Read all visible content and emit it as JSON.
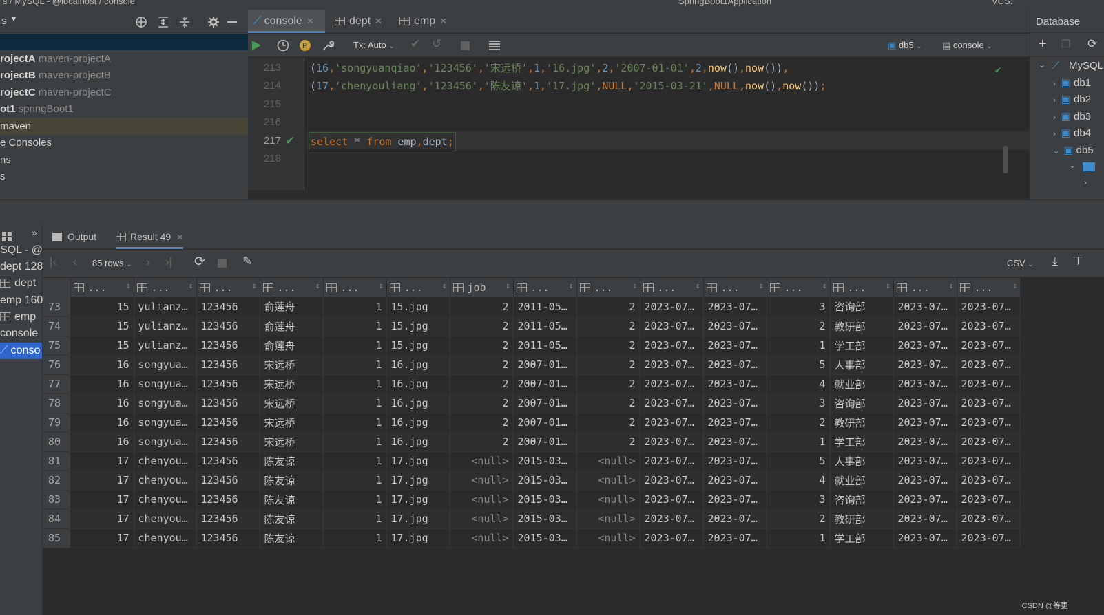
{
  "topbar": {
    "path": "s / MySQL - @localhost / console",
    "run_config": "SpringBoot1Application",
    "vcs": "VCS:"
  },
  "project_panel": {
    "header_label": "s",
    "items": [
      {
        "bold": "rojectA",
        "muted": "maven-projectA"
      },
      {
        "bold": "rojectB",
        "muted": "maven-projectB"
      },
      {
        "bold": "rojectC",
        "muted": "maven-projectC"
      },
      {
        "bold": "ot1",
        "muted": "springBoot1"
      },
      {
        "bold": "",
        "muted": "",
        "text": "maven"
      },
      {
        "bold": "",
        "muted": "",
        "text": "e Consoles"
      },
      {
        "bold": "",
        "muted": "",
        "text": "ns"
      },
      {
        "bold": "",
        "muted": "",
        "text": "s"
      }
    ]
  },
  "editor": {
    "tabs": [
      {
        "label": "console",
        "active": true
      },
      {
        "label": "dept"
      },
      {
        "label": "emp"
      }
    ],
    "toolbar": {
      "tx": "Tx: Auto",
      "schema": "db5",
      "session": "console"
    },
    "line_numbers": [
      "213",
      "214",
      "215",
      "216",
      "217",
      "218"
    ],
    "current_line": "217",
    "lines": [
      "(16,'songyuanqiao','123456','宋远桥',1,'16.jpg',2,'2007-01-01',2,now(),now()),",
      "(17,'chenyouliang','123456','陈友谅',1,'17.jpg',NULL,'2015-03-21',NULL,now(),now());",
      "",
      "",
      "select * from emp,dept;",
      ""
    ]
  },
  "database_panel": {
    "title": "Database",
    "root": "MySQL",
    "schemas": [
      "db1",
      "db2",
      "db3",
      "db4",
      "db5"
    ]
  },
  "services": {
    "items": [
      "SQL - @lo",
      "dept 128",
      "dept",
      "emp 160",
      "emp",
      "console",
      "conso"
    ],
    "selected": "conso"
  },
  "results": {
    "tabs": [
      {
        "label": "Output"
      },
      {
        "label": "Result 49",
        "active": true
      }
    ],
    "rows_label": "85 rows",
    "export_label": "CSV",
    "columns": [
      "...",
      "...",
      "...",
      "...",
      "...",
      "...",
      "job",
      "...",
      "...",
      "...",
      "...",
      "...",
      "...",
      "...",
      "..."
    ],
    "rows": [
      [
        "73",
        "15",
        "yulianz…",
        "123456",
        "俞莲舟",
        "1",
        "15.jpg",
        "2",
        "2011-05…",
        "2",
        "2023-07…",
        "2023-07…",
        "3",
        "咨询部",
        "2023-07…",
        "2023-07…"
      ],
      [
        "74",
        "15",
        "yulianz…",
        "123456",
        "俞莲舟",
        "1",
        "15.jpg",
        "2",
        "2011-05…",
        "2",
        "2023-07…",
        "2023-07…",
        "2",
        "教研部",
        "2023-07…",
        "2023-07…"
      ],
      [
        "75",
        "15",
        "yulianz…",
        "123456",
        "俞莲舟",
        "1",
        "15.jpg",
        "2",
        "2011-05…",
        "2",
        "2023-07…",
        "2023-07…",
        "1",
        "学工部",
        "2023-07…",
        "2023-07…"
      ],
      [
        "76",
        "16",
        "songyua…",
        "123456",
        "宋远桥",
        "1",
        "16.jpg",
        "2",
        "2007-01…",
        "2",
        "2023-07…",
        "2023-07…",
        "5",
        "人事部",
        "2023-07…",
        "2023-07…"
      ],
      [
        "77",
        "16",
        "songyua…",
        "123456",
        "宋远桥",
        "1",
        "16.jpg",
        "2",
        "2007-01…",
        "2",
        "2023-07…",
        "2023-07…",
        "4",
        "就业部",
        "2023-07…",
        "2023-07…"
      ],
      [
        "78",
        "16",
        "songyua…",
        "123456",
        "宋远桥",
        "1",
        "16.jpg",
        "2",
        "2007-01…",
        "2",
        "2023-07…",
        "2023-07…",
        "3",
        "咨询部",
        "2023-07…",
        "2023-07…"
      ],
      [
        "79",
        "16",
        "songyua…",
        "123456",
        "宋远桥",
        "1",
        "16.jpg",
        "2",
        "2007-01…",
        "2",
        "2023-07…",
        "2023-07…",
        "2",
        "教研部",
        "2023-07…",
        "2023-07…"
      ],
      [
        "80",
        "16",
        "songyua…",
        "123456",
        "宋远桥",
        "1",
        "16.jpg",
        "2",
        "2007-01…",
        "2",
        "2023-07…",
        "2023-07…",
        "1",
        "学工部",
        "2023-07…",
        "2023-07…"
      ],
      [
        "81",
        "17",
        "chenyou…",
        "123456",
        "陈友谅",
        "1",
        "17.jpg",
        "<null>",
        "2015-03…",
        "<null>",
        "2023-07…",
        "2023-07…",
        "5",
        "人事部",
        "2023-07…",
        "2023-07…"
      ],
      [
        "82",
        "17",
        "chenyou…",
        "123456",
        "陈友谅",
        "1",
        "17.jpg",
        "<null>",
        "2015-03…",
        "<null>",
        "2023-07…",
        "2023-07…",
        "4",
        "就业部",
        "2023-07…",
        "2023-07…"
      ],
      [
        "83",
        "17",
        "chenyou…",
        "123456",
        "陈友谅",
        "1",
        "17.jpg",
        "<null>",
        "2015-03…",
        "<null>",
        "2023-07…",
        "2023-07…",
        "3",
        "咨询部",
        "2023-07…",
        "2023-07…"
      ],
      [
        "84",
        "17",
        "chenyou…",
        "123456",
        "陈友谅",
        "1",
        "17.jpg",
        "<null>",
        "2015-03…",
        "<null>",
        "2023-07…",
        "2023-07…",
        "2",
        "教研部",
        "2023-07…",
        "2023-07…"
      ],
      [
        "85",
        "17",
        "chenyou…",
        "123456",
        "陈友谅",
        "1",
        "17.jpg",
        "<null>",
        "2015-03…",
        "<null>",
        "2023-07…",
        "2023-07…",
        "1",
        "学工部",
        "2023-07…",
        "2023-07…"
      ]
    ]
  },
  "watermark": "CSDN @等更"
}
